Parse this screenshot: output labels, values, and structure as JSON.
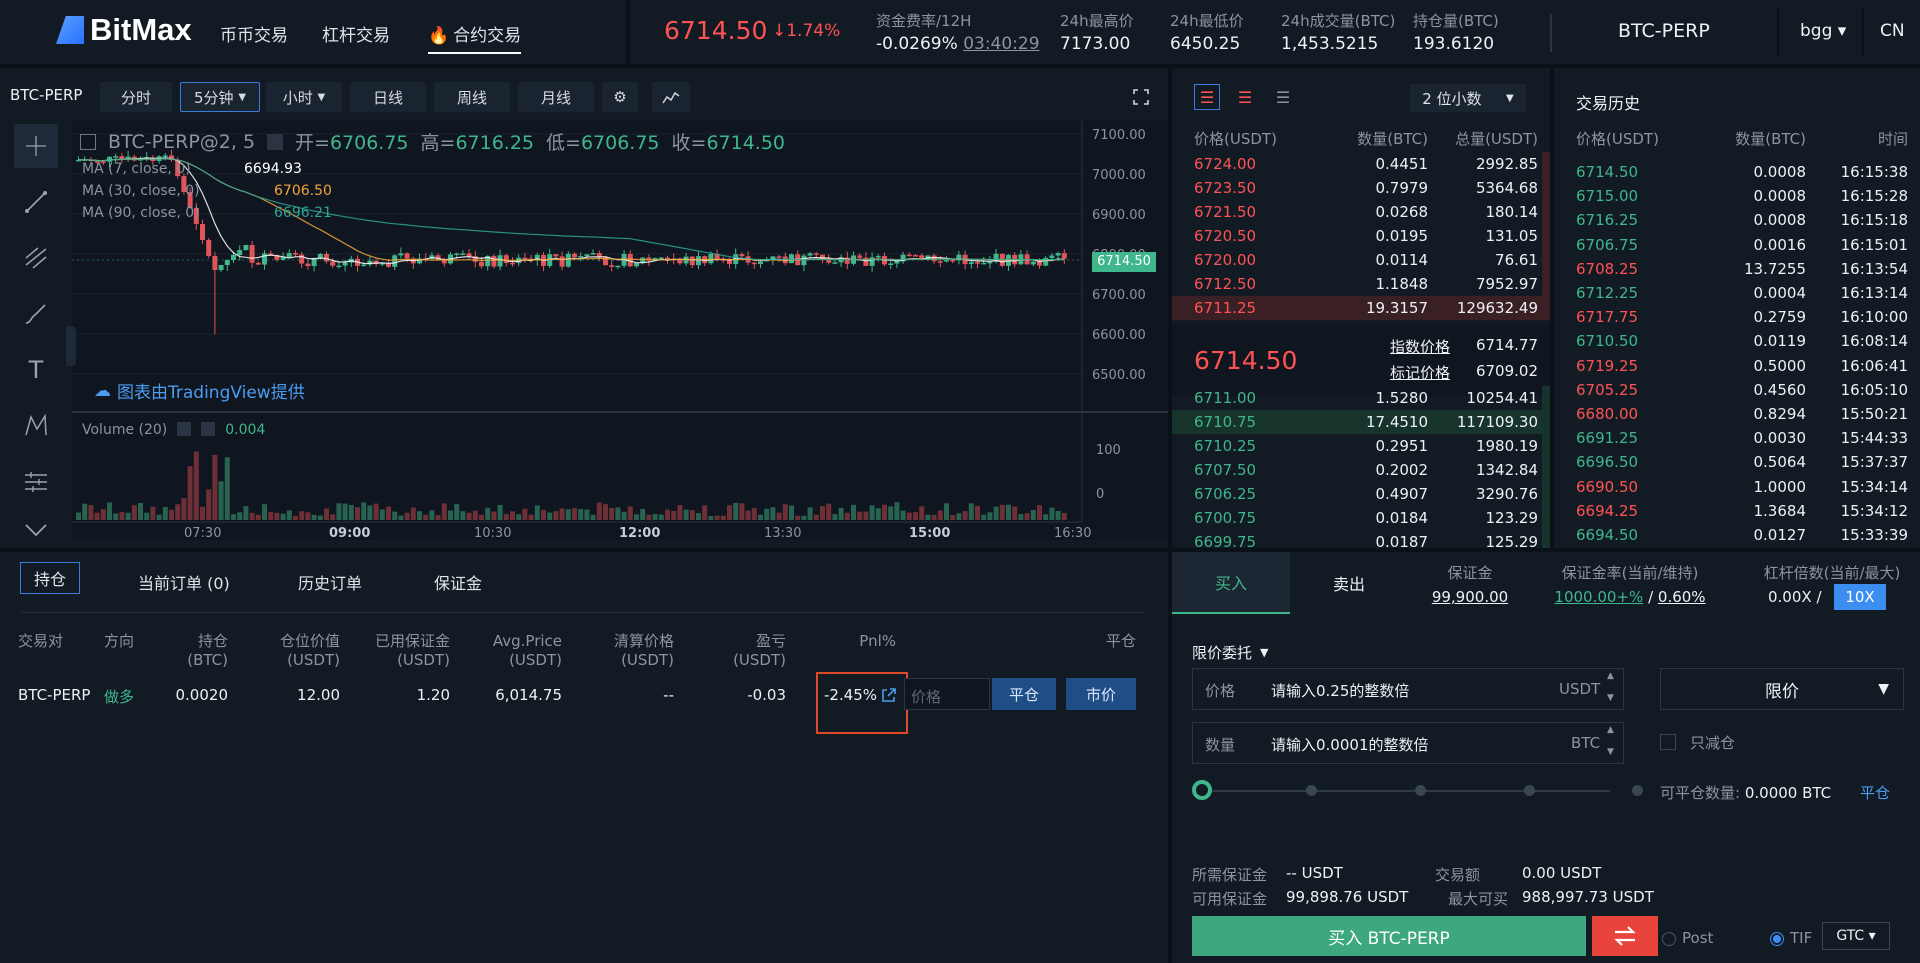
{
  "brand": {
    "name": "BitMax"
  },
  "nav": [
    "币币交易",
    "杠杆交易",
    "合约交易"
  ],
  "ticker": {
    "price": "6714.50",
    "change": "↓1.74%",
    "funding_label": "资金费率/12H",
    "funding_value": "-0.0269%",
    "funding_countdown": "03:40:29",
    "high_label": "24h最高价",
    "high_value": "7173.00",
    "low_label": "24h最低价",
    "low_value": "6450.25",
    "volume_label": "24h成交量(BTC)",
    "volume_value": "1,453.5215",
    "oi_label": "持仓量(BTC)",
    "oi_value": "193.6120"
  },
  "header_right": {
    "pair": "BTC-PERP",
    "user": "bgg ▾",
    "lang": "CN"
  },
  "chart_toolbar": {
    "symbol": "BTC-PERP",
    "buttons": [
      "分时",
      "5分钟",
      "小时",
      "日线",
      "周线",
      "月线"
    ],
    "selected": "5分钟"
  },
  "chart_legend": {
    "title": "BTC-PERP@2, 5",
    "open_label": "开=",
    "open": "6706.75",
    "high_label": "高=",
    "high": "6716.25",
    "low_label": "低=",
    "low": "6706.75",
    "close_label": "收=",
    "close": "6714.50",
    "ma7_label": "MA (7, close, 0)",
    "ma7": "6694.93",
    "ma30_label": "MA (30, close, 0)",
    "ma30": "6706.50",
    "ma90_label": "MA (90, close, 0)",
    "ma90": "6696.21",
    "volume_label": "Volume (20)",
    "volume": "0.004",
    "credit": "图表由TradingView提供",
    "last_price_tag": "6714.50"
  },
  "chart_data": {
    "type": "line",
    "price_axis": [
      "7100.00",
      "7000.00",
      "6900.00",
      "6800.00",
      "6700.00",
      "6600.00",
      "6500.00"
    ],
    "volume_axis": [
      "100",
      "0"
    ],
    "time_axis": [
      "07:30",
      "09:00",
      "10:30",
      "12:00",
      "13:30",
      "15:00",
      "16:30"
    ],
    "series": [
      {
        "name": "MA (7, close, 0)",
        "color": "#ffffff"
      },
      {
        "name": "MA (30, close, 0)",
        "color": "#f0a43c"
      },
      {
        "name": "MA (90, close, 0)",
        "color": "#2ea597"
      }
    ]
  },
  "orderbook": {
    "decimals": "2 位小数",
    "headers": [
      "价格(USDT)",
      "数量(BTC)",
      "总量(USDT)"
    ],
    "asks": [
      [
        "6724.00",
        "0.4451",
        "2992.85"
      ],
      [
        "6723.50",
        "0.7979",
        "5364.68"
      ],
      [
        "6721.50",
        "0.0268",
        "180.14"
      ],
      [
        "6720.50",
        "0.0195",
        "131.05"
      ],
      [
        "6720.00",
        "0.0114",
        "76.61"
      ],
      [
        "6712.50",
        "1.1848",
        "7952.97"
      ],
      [
        "6711.25",
        "19.3157",
        "129632.49"
      ]
    ],
    "last_price": "6714.50",
    "index_label": "指数价格",
    "index_value": "6714.77",
    "mark_label": "标记价格",
    "mark_value": "6709.02",
    "bids": [
      [
        "6711.00",
        "1.5280",
        "10254.41"
      ],
      [
        "6710.75",
        "17.4510",
        "117109.30"
      ],
      [
        "6710.25",
        "0.2951",
        "1980.19"
      ],
      [
        "6707.50",
        "0.2002",
        "1342.84"
      ],
      [
        "6706.25",
        "0.4907",
        "3290.76"
      ],
      [
        "6700.75",
        "0.0184",
        "123.29"
      ],
      [
        "6699.75",
        "0.0187",
        "125.29"
      ]
    ]
  },
  "trades": {
    "title": "交易历史",
    "headers": [
      "价格(USDT)",
      "数量(BTC)",
      "时间"
    ],
    "rows": [
      [
        "6714.50",
        "0.0008",
        "16:15:38",
        "up"
      ],
      [
        "6715.00",
        "0.0008",
        "16:15:28",
        "up"
      ],
      [
        "6716.25",
        "0.0008",
        "16:15:18",
        "up"
      ],
      [
        "6706.75",
        "0.0016",
        "16:15:01",
        "up"
      ],
      [
        "6708.25",
        "13.7255",
        "16:13:54",
        "down"
      ],
      [
        "6712.25",
        "0.0004",
        "16:13:14",
        "up"
      ],
      [
        "6717.75",
        "0.2759",
        "16:10:00",
        "down"
      ],
      [
        "6710.50",
        "0.0119",
        "16:08:14",
        "up"
      ],
      [
        "6719.25",
        "0.5000",
        "16:06:41",
        "down"
      ],
      [
        "6705.25",
        "0.4560",
        "16:05:10",
        "down"
      ],
      [
        "6680.00",
        "0.8294",
        "15:50:21",
        "down"
      ],
      [
        "6691.25",
        "0.0030",
        "15:44:33",
        "up"
      ],
      [
        "6696.50",
        "0.5064",
        "15:37:37",
        "up"
      ],
      [
        "6690.50",
        "1.0000",
        "15:34:14",
        "down"
      ],
      [
        "6694.25",
        "1.3684",
        "15:34:12",
        "down"
      ],
      [
        "6694.50",
        "0.0127",
        "15:33:39",
        "up"
      ]
    ]
  },
  "positions": {
    "tabs": [
      "持仓",
      "当前订单 (0)",
      "历史订单",
      "保证金"
    ],
    "headers": [
      [
        "交易对",
        ""
      ],
      [
        "方向",
        ""
      ],
      [
        "持仓",
        "(BTC)"
      ],
      [
        "仓位价值",
        "(USDT)"
      ],
      [
        "已用保证金",
        "(USDT)"
      ],
      [
        "Avg.Price",
        "(USDT)"
      ],
      [
        "清算价格",
        "(USDT)"
      ],
      [
        "盈亏",
        "(USDT)"
      ],
      [
        "Pnl%",
        ""
      ],
      [
        "平仓",
        ""
      ]
    ],
    "row": {
      "pair": "BTC-PERP",
      "side": "做多",
      "size": "0.0020",
      "value": "12.00",
      "margin": "1.20",
      "avg_price": "6,014.75",
      "liq_price": "--",
      "pnl": "-0.03",
      "pnl_pct": "-2.45%",
      "price_placeholder": "价格",
      "close_btn": "平仓",
      "market_btn": "市价"
    }
  },
  "order_form": {
    "buy_tab": "买入",
    "sell_tab": "卖出",
    "margin_label": "保证金",
    "margin_value": "99,900.00",
    "ratio_label": "保证金率(当前/维持)",
    "ratio_current": "1000.00+%",
    "ratio_sep": "/",
    "ratio_maint": "0.60%",
    "lev_label": "杠杆倍数(当前/最大)",
    "lev_current": "0.00X",
    "lev_sep": "/",
    "lev_max": "10X",
    "order_type_label": "限价委托",
    "price_label": "价格",
    "price_placeholder": "请输入0.25的整数倍",
    "price_unit": "USDT",
    "qty_label": "数量",
    "qty_placeholder": "请输入0.0001的整数倍",
    "qty_unit": "BTC",
    "type_select": "限价",
    "reduce_only": "只减仓",
    "closeable_label": "可平仓数量:",
    "closeable_value": "0.0000 BTC",
    "close_link": "平仓",
    "req_margin_label": "所需保证金",
    "req_margin_value": "-- USDT",
    "trade_amount_label": "交易额",
    "trade_amount_value": "0.00 USDT",
    "avail_margin_label": "可用保证金",
    "avail_margin_value": "99,898.76 USDT",
    "max_buy_label": "最大可买",
    "max_buy_value": "988,997.73 USDT",
    "submit": "买入 BTC-PERP",
    "post_label": "Post",
    "tif_label": "TIF",
    "tif_value": "GTC ▾",
    "slider_percent": 0
  }
}
